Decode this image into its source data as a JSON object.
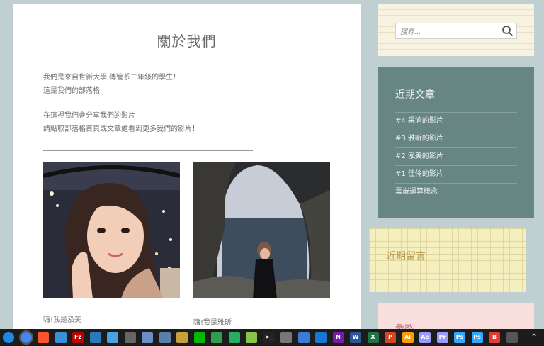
{
  "main": {
    "title": "關於我們",
    "intro_line1": "我們是來自世新大學 傳管系二年級的學生！",
    "intro_line2": "這是我們的部落格",
    "share_line1": "在這裡我們會分享我們的影片",
    "share_line2": "請點取部落格首頁或文章處看到更多我們的影片！",
    "photos": [
      {
        "caption": "嗨!我是泓美"
      },
      {
        "caption": "嗨!我是雅昕"
      }
    ]
  },
  "sidebar": {
    "search": {
      "placeholder": "搜尋..."
    },
    "recent_posts": {
      "title": "近期文章",
      "items": [
        "#4 采渝的影片",
        "#3 雅昕的影片",
        "#2 泓美的影片",
        "#1 佳伶的影片",
        "雲端運算概念"
      ]
    },
    "recent_comments": {
      "title": "近期留言"
    },
    "archive": {
      "title": "彙整"
    }
  },
  "taskbar": {
    "icons": [
      {
        "name": "windows-logo-icon",
        "color": "#1e88e5",
        "glyph": ""
      },
      {
        "name": "chrome-icon",
        "color": "#4285f4",
        "glyph": ""
      },
      {
        "name": "brave-icon",
        "color": "#fb542b",
        "glyph": ""
      },
      {
        "name": "window-icon",
        "color": "#3b8fd6",
        "glyph": ""
      },
      {
        "name": "filezilla-icon",
        "color": "#bf0000",
        "glyph": "Fz"
      },
      {
        "name": "explorer-icon",
        "color": "#2a7ab8",
        "glyph": ""
      },
      {
        "name": "monitor-icon",
        "color": "#4aa3df",
        "glyph": ""
      },
      {
        "name": "calculator-app-icon",
        "color": "#666666",
        "glyph": ""
      },
      {
        "name": "network-icon",
        "color": "#6a8fc7",
        "glyph": ""
      },
      {
        "name": "photo-app-icon",
        "color": "#5a7fa8",
        "glyph": ""
      },
      {
        "name": "settings-app-icon",
        "color": "#c9a13b",
        "glyph": ""
      },
      {
        "name": "line-icon",
        "color": "#00b900",
        "glyph": ""
      },
      {
        "name": "green-app-icon",
        "color": "#2e9e4f",
        "glyph": ""
      },
      {
        "name": "sync-icon",
        "color": "#27ae60",
        "glyph": ""
      },
      {
        "name": "link-app-icon",
        "color": "#8bc34a",
        "glyph": ""
      },
      {
        "name": "terminal-icon",
        "color": "#222222",
        "glyph": ">_"
      },
      {
        "name": "calculator-icon",
        "color": "#777777",
        "glyph": ""
      },
      {
        "name": "grid-app-icon",
        "color": "#3a7bd5",
        "glyph": ""
      },
      {
        "name": "blue-app-icon",
        "color": "#1976d2",
        "glyph": ""
      },
      {
        "name": "onenote-icon",
        "color": "#7719aa",
        "glyph": "N"
      },
      {
        "name": "word-icon",
        "color": "#2b579a",
        "glyph": "W"
      },
      {
        "name": "excel-icon",
        "color": "#217346",
        "glyph": "X"
      },
      {
        "name": "powerpoint-icon",
        "color": "#d24726",
        "glyph": "P"
      },
      {
        "name": "illustrator-icon",
        "color": "#ff9a00",
        "glyph": "Ai"
      },
      {
        "name": "after-effects-icon",
        "color": "#9999ff",
        "glyph": "Ae"
      },
      {
        "name": "premiere-icon",
        "color": "#9999ff",
        "glyph": "Pr"
      },
      {
        "name": "photoshop-icon",
        "color": "#31a8ff",
        "glyph": "Ps"
      },
      {
        "name": "photoshop-icon-2",
        "color": "#31a8ff",
        "glyph": "Ps"
      },
      {
        "name": "b-app-icon",
        "color": "#e53935",
        "glyph": "B"
      },
      {
        "name": "clock-icon",
        "color": "#555555",
        "glyph": ""
      }
    ],
    "tray_glyph": "^"
  }
}
